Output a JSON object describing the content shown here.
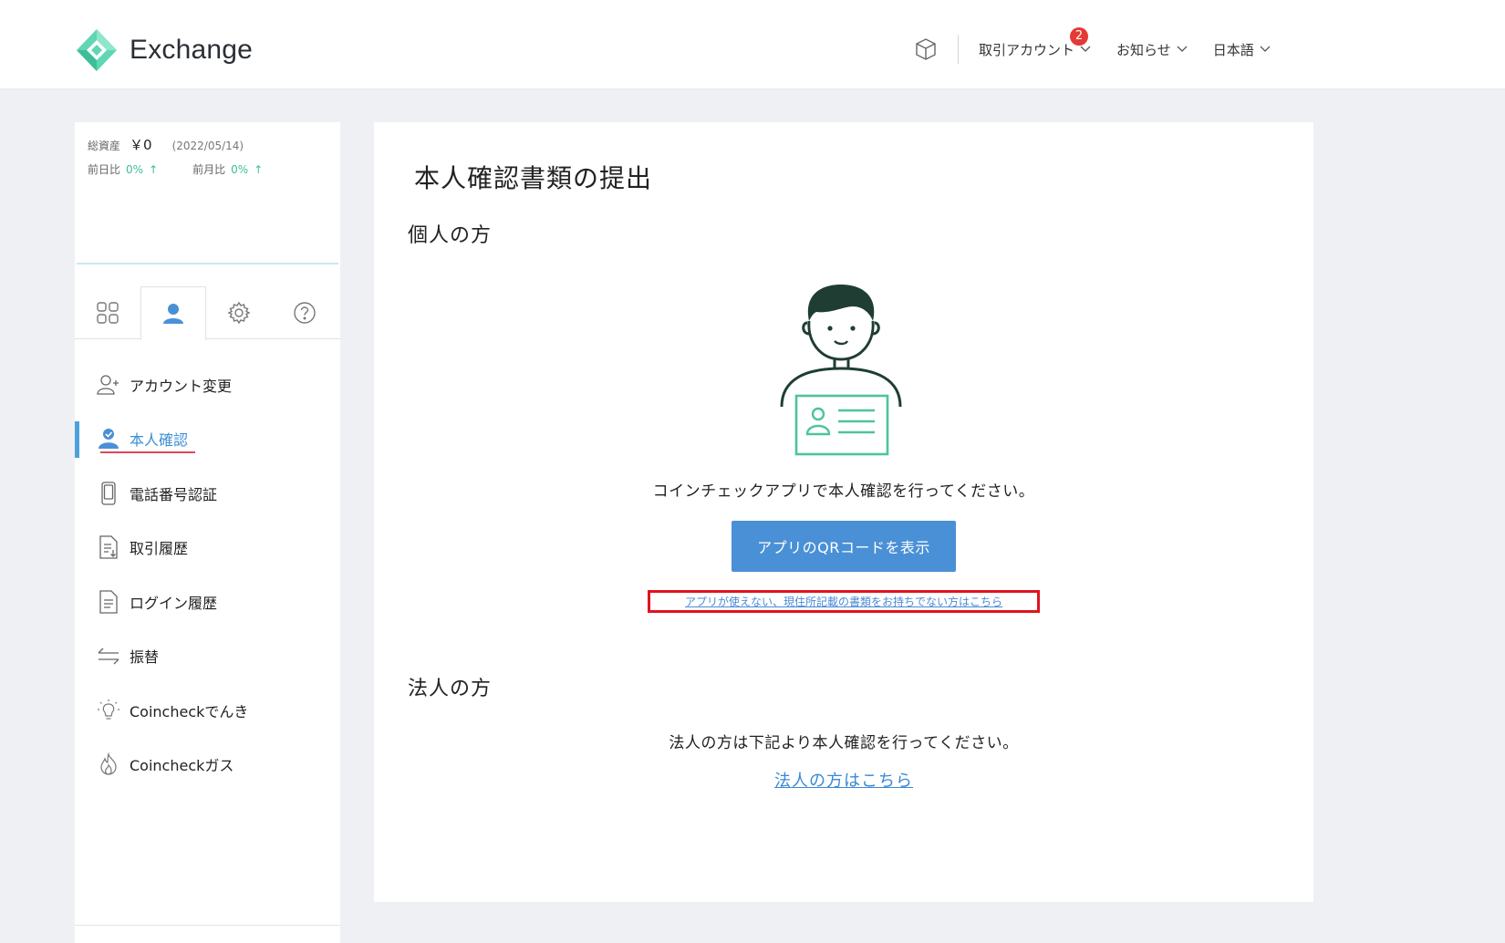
{
  "header": {
    "brand": "Exchange",
    "menus": [
      {
        "label": "取引アカウント",
        "badge": "2"
      },
      {
        "label": "お知らせ"
      },
      {
        "label": "日本語"
      }
    ],
    "icons": [
      "cube-icon",
      "chevron-down-icon"
    ]
  },
  "sidebar": {
    "assets": {
      "total_label": "総資産",
      "total_value": "￥0",
      "date": "(2022/05/14)",
      "prev_day_label": "前日比",
      "prev_day_pct": "0%",
      "prev_month_label": "前月比",
      "prev_month_pct": "0%"
    },
    "tabs": [
      {
        "icon": "grid-icon"
      },
      {
        "icon": "user-icon",
        "active": true
      },
      {
        "icon": "gear-icon"
      },
      {
        "icon": "help-icon"
      }
    ],
    "items": [
      {
        "label": "アカウント変更",
        "icon": "user-plus-icon"
      },
      {
        "label": "本人確認",
        "icon": "user-check-icon",
        "active": true
      },
      {
        "label": "電話番号認証",
        "icon": "phone-icon"
      },
      {
        "label": "取引履歴",
        "icon": "document-download-icon"
      },
      {
        "label": "ログイン履歴",
        "icon": "document-icon"
      },
      {
        "label": "振替",
        "icon": "transfer-icon"
      },
      {
        "label": "Coincheckでんき",
        "icon": "bulb-icon"
      },
      {
        "label": "Coincheckガス",
        "icon": "flame-icon"
      }
    ]
  },
  "main": {
    "title": "本人確認書類の提出",
    "individual": {
      "heading": "個人の方",
      "instruction": "コインチェックアプリで本人確認を行ってください。",
      "qr_button": "アプリのQRコードを表示",
      "alt_link": "アプリが使えない、現住所記載の書類をお持ちでない方はこちら"
    },
    "corporate": {
      "heading": "法人の方",
      "instruction": "法人の方は下記より本人確認を行ってください。",
      "link": "法人の方はこちら"
    }
  },
  "colors": {
    "brand_green": "#3ebd9b",
    "primary_blue": "#4a90d6",
    "highlight_red": "#e0131f",
    "active_bar": "#4ea0dc"
  }
}
